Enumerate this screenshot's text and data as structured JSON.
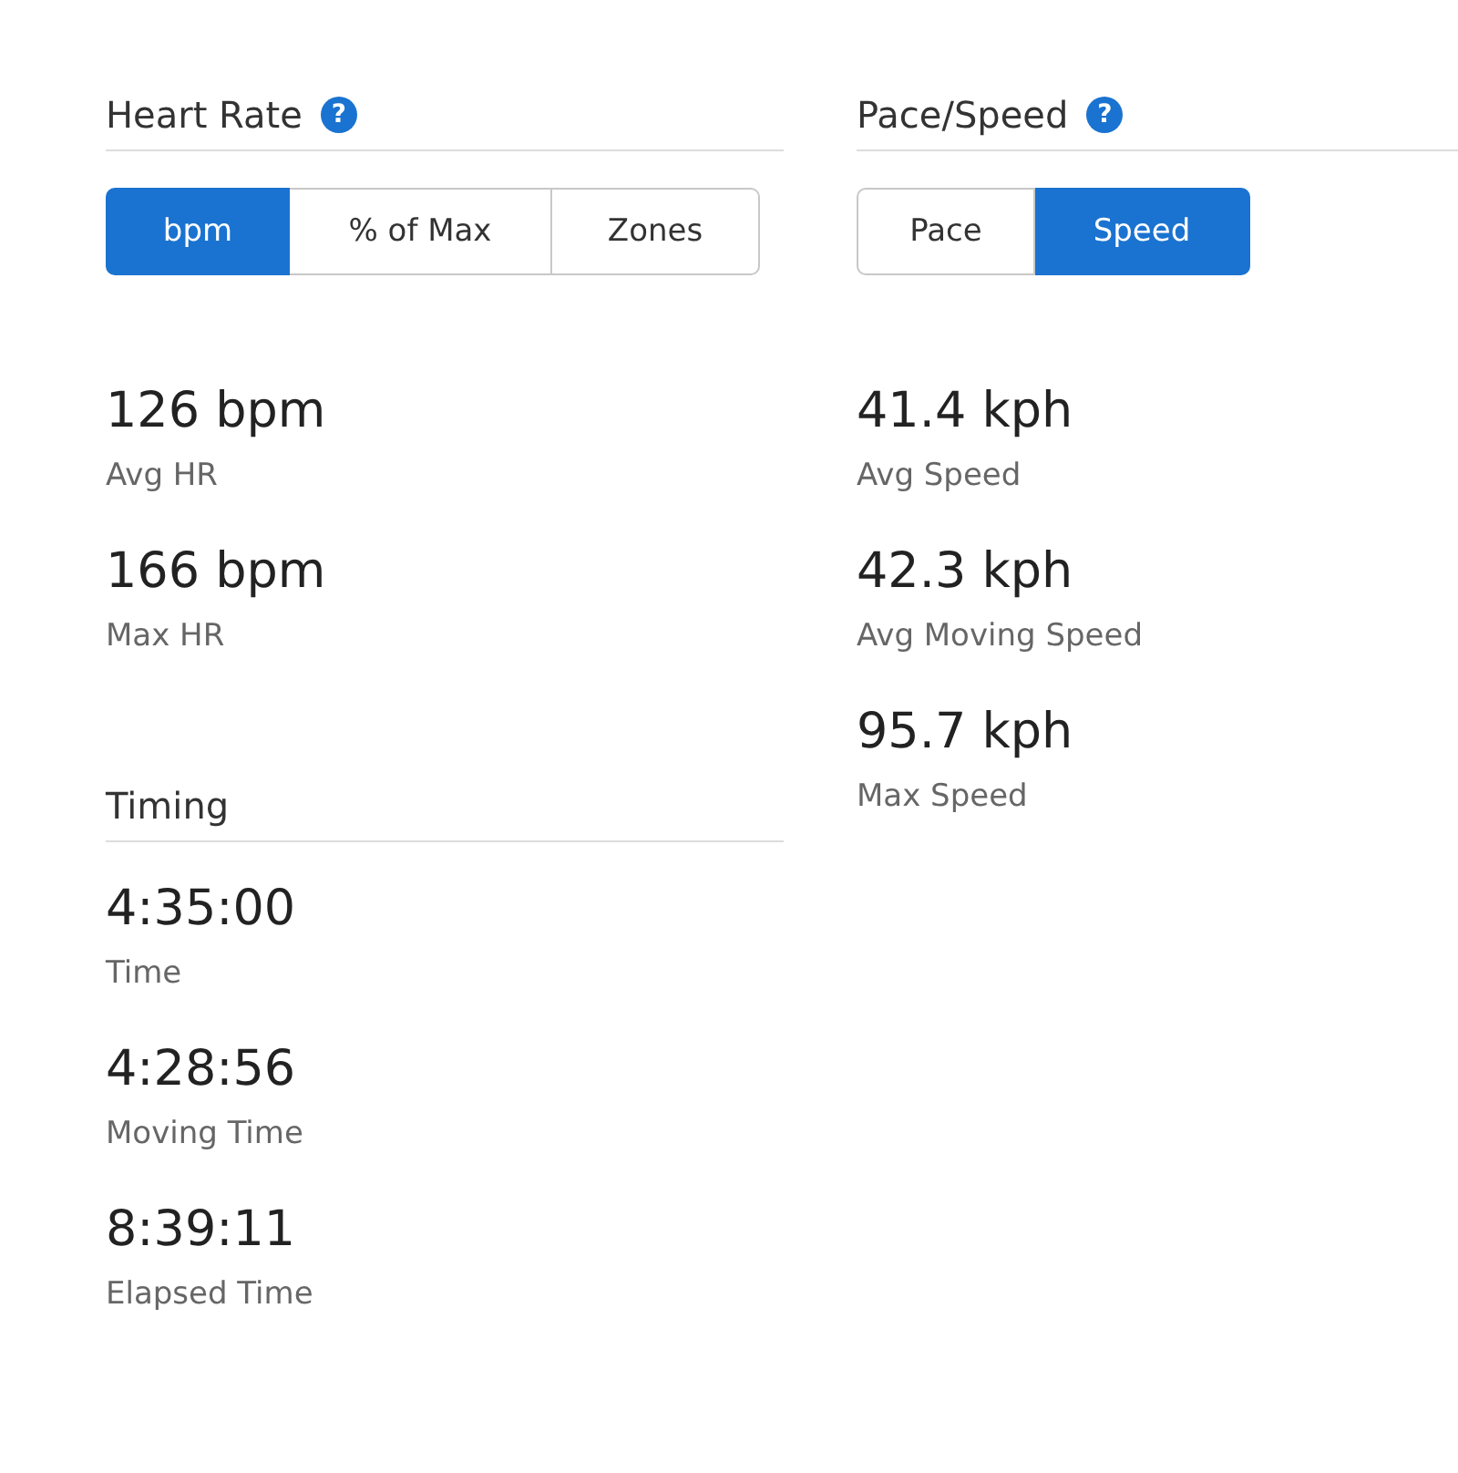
{
  "heart_rate": {
    "title": "Heart Rate",
    "help": "?",
    "units": [
      {
        "label": "bpm",
        "selected": true
      },
      {
        "label": "% of Max",
        "selected": false
      },
      {
        "label": "Zones",
        "selected": false
      }
    ],
    "stats": [
      {
        "value": "126 bpm",
        "label": "Avg HR"
      },
      {
        "value": "166 bpm",
        "label": "Max HR"
      }
    ]
  },
  "timing": {
    "title": "Timing",
    "stats": [
      {
        "value": "4:35:00",
        "label": "Time"
      },
      {
        "value": "4:28:56",
        "label": "Moving Time"
      },
      {
        "value": "8:39:11",
        "label": "Elapsed Time"
      }
    ]
  },
  "pace_speed": {
    "title": "Pace/Speed",
    "help": "?",
    "units": [
      {
        "label": "Pace",
        "selected": false
      },
      {
        "label": "Speed",
        "selected": true
      }
    ],
    "stats": [
      {
        "value": "41.4 kph",
        "label": "Avg Speed"
      },
      {
        "value": "42.3 kph",
        "label": "Avg Moving Speed"
      },
      {
        "value": "95.7 kph",
        "label": "Max Speed"
      }
    ]
  }
}
